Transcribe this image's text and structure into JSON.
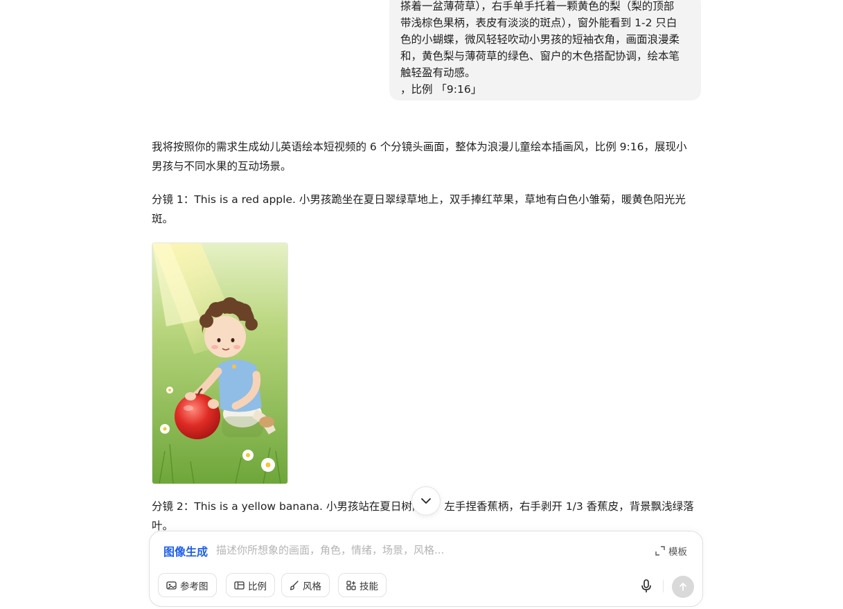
{
  "user_message": {
    "lines": [
      "搽着一盆薄荷草），右手单手托着一颗黄色的梨（梨的顶部",
      "带浅棕色果柄，表皮有淡淡的斑点），窗外能看到 1-2 只白",
      "色的小蝴蝶，微风轻轻吹动小男孩的短袖衣角，画面浪漫柔",
      "和，黄色梨与薄荷草的绿色、窗户的木色搭配协调，绘本笔",
      "触轻盈有动感。",
      "，比例 「9:16」"
    ]
  },
  "assistant": {
    "intro_lines": [
      "我将按照你的需求生成幼儿英语绘本短视频的 6 个分镜头画面，整体为浪漫儿童绘本插画风，比例 9:16，展现小",
      "男孩与不同水果的互动场景。"
    ],
    "scene1_lines": [
      "分镜 1：This is a red apple. 小男孩跪坐在夏日翠绿草地上，双手捧红苹果，草地有白色小雏菊，暖黄色阳光光",
      "斑。"
    ],
    "scene2_lines": [
      "分镜 2：This is a yellow banana. 小男孩站在夏日树荫下，左手捏香蕉柄，右手剥开 1/3 香蕉皮，背景飘浅绿落",
      "叶。"
    ]
  },
  "composer": {
    "mode_label": "图像生成",
    "placeholder": "描述你所想象的画面，角色，情绪，场景，风格...",
    "value": "",
    "template_label": "模板",
    "tools": [
      {
        "label": "参考图",
        "icon": "image-icon"
      },
      {
        "label": "比例",
        "icon": "ratio-icon"
      },
      {
        "label": "风格",
        "icon": "brush-icon"
      },
      {
        "label": "技能",
        "icon": "skills-icon"
      }
    ]
  },
  "colors": {
    "accent": "#1f5fe8",
    "bubble_bg": "#f3f3f3",
    "send_disabled": "#d9d9d9"
  }
}
